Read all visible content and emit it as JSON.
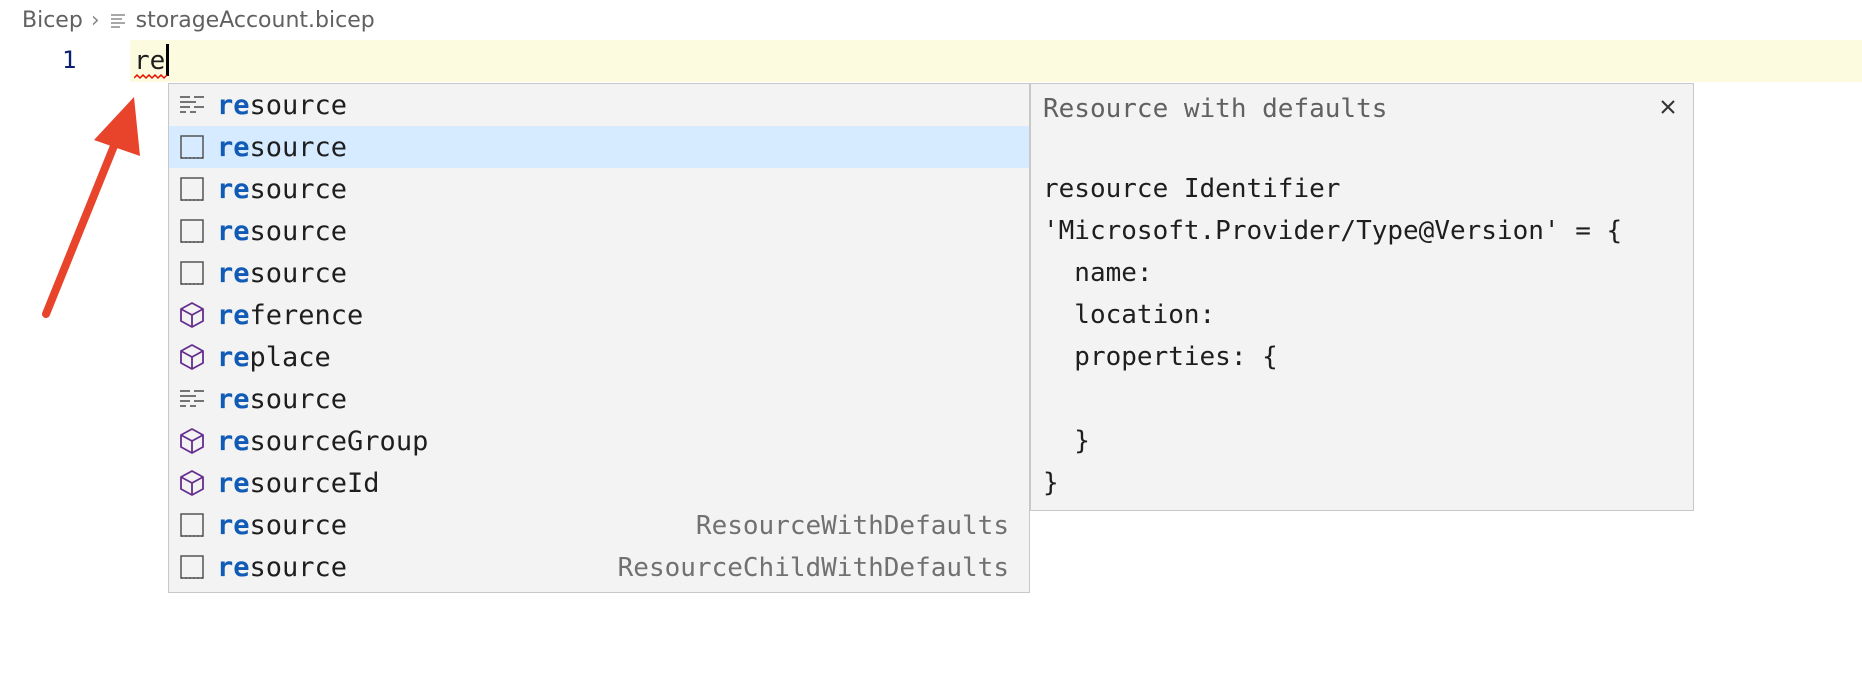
{
  "breadcrumb": {
    "root": "Bicep",
    "file": "storageAccount.bicep"
  },
  "editor": {
    "line_number": "1",
    "typed_text": "re"
  },
  "suggestions": [
    {
      "match": "re",
      "rest": "source",
      "kind": "snippet-icon",
      "detail": ""
    },
    {
      "match": "re",
      "rest": "source",
      "kind": "keyword-icon",
      "detail": "",
      "selected": true
    },
    {
      "match": "re",
      "rest": "source",
      "kind": "keyword-icon",
      "detail": ""
    },
    {
      "match": "re",
      "rest": "source",
      "kind": "keyword-icon",
      "detail": ""
    },
    {
      "match": "re",
      "rest": "source",
      "kind": "keyword-icon",
      "detail": ""
    },
    {
      "match": "re",
      "rest": "ference",
      "kind": "function-icon",
      "detail": ""
    },
    {
      "match": "re",
      "rest": "place",
      "kind": "function-icon",
      "detail": ""
    },
    {
      "match": "re",
      "rest": "source",
      "kind": "snippet-icon",
      "detail": ""
    },
    {
      "match": "re",
      "rest": "sourceGroup",
      "kind": "function-icon",
      "detail": ""
    },
    {
      "match": "re",
      "rest": "sourceId",
      "kind": "function-icon",
      "detail": ""
    },
    {
      "match": "re",
      "rest": "source",
      "kind": "keyword-icon",
      "detail": "ResourceWithDefaults"
    },
    {
      "match": "re",
      "rest": "source",
      "kind": "keyword-icon",
      "detail": "ResourceChildWithDefaults"
    }
  ],
  "details": {
    "title": "Resource with defaults",
    "code": "resource Identifier\n'Microsoft.Provider/Type@Version' = {\n  name:\n  location:\n  properties: {\n\n  }\n}"
  },
  "colors": {
    "match_highlight": "#0f5bb5",
    "selected_row": "#d6ebff",
    "current_line": "#fdfbdf",
    "annotation_arrow": "#e8432b",
    "function_icon": "#652d90"
  }
}
